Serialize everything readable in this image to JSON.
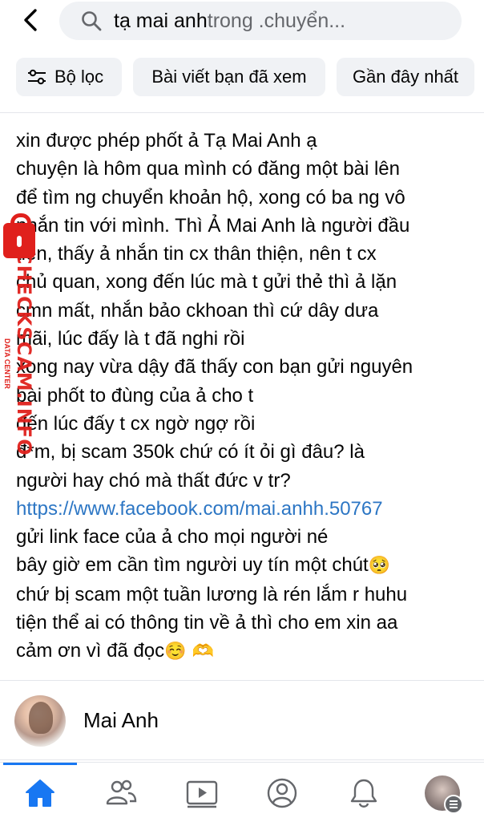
{
  "search": {
    "query": "tạ mai anh",
    "scope": " trong .chuyển..."
  },
  "filters": [
    {
      "label": "Bộ lọc",
      "icon": "sliders-icon"
    },
    {
      "label": "Bài viết bạn đã xem"
    },
    {
      "label": "Gần đây nhất"
    }
  ],
  "post": {
    "lines": [
      "xin được phép phốt ả Tạ Mai Anh ạ",
      "chuyện là hôm qua mình có đăng một bài lên",
      "để tìm ng chuyển khoản hộ, xong có ba ng vô",
      "nhắn tin với mình. Thì Ả Mai Anh là người đầu",
      "tiên, thấy ả nhắn tin cx thân thiện, nên t cx",
      "chủ quan, xong đến lúc mà t gửi thẻ thì ả lặn",
      "cmn mất, nhắn bảo ckhoan thì cứ dây dưa",
      "mãi, lúc đấy là t đã nghi rồi",
      "xong nay vừa dậy đã thấy con bạn gửi nguyên",
      "bài phốt to đùng của ả cho t",
      "đến lúc đấy t cx ngờ ngợ rồi",
      " đ*m, bị scam 350k chứ có ít ỏi gì đâu? là",
      "người hay chó mà thất đức v tr?"
    ],
    "link": "https://www.facebook.com/mai.anhh.50767",
    "lines2": [
      "gửi link face của ả cho mọi người né",
      "bây giờ em cần tìm người uy tín một chút",
      "chứ bị scam một tuần lương là rén lắm r huhu",
      "tiện thể ai có thông tin về ả thì cho em xin aa",
      " cảm ơn vì đã đọc"
    ],
    "emoji_pleading": "🥺",
    "emoji_end": "☺️ 🫶"
  },
  "watermark": {
    "text": "CHECKSCAM.INFO",
    "subtext": "DATA CENTER"
  },
  "profile": {
    "name": "Mai Anh"
  },
  "nav": [
    "home-icon",
    "friends-icon",
    "watch-icon",
    "profile-icon",
    "notifications-icon",
    "menu-avatar"
  ],
  "colors": {
    "accent": "#1877f2",
    "link": "#2c76c4",
    "watermark": "#e0201c"
  }
}
